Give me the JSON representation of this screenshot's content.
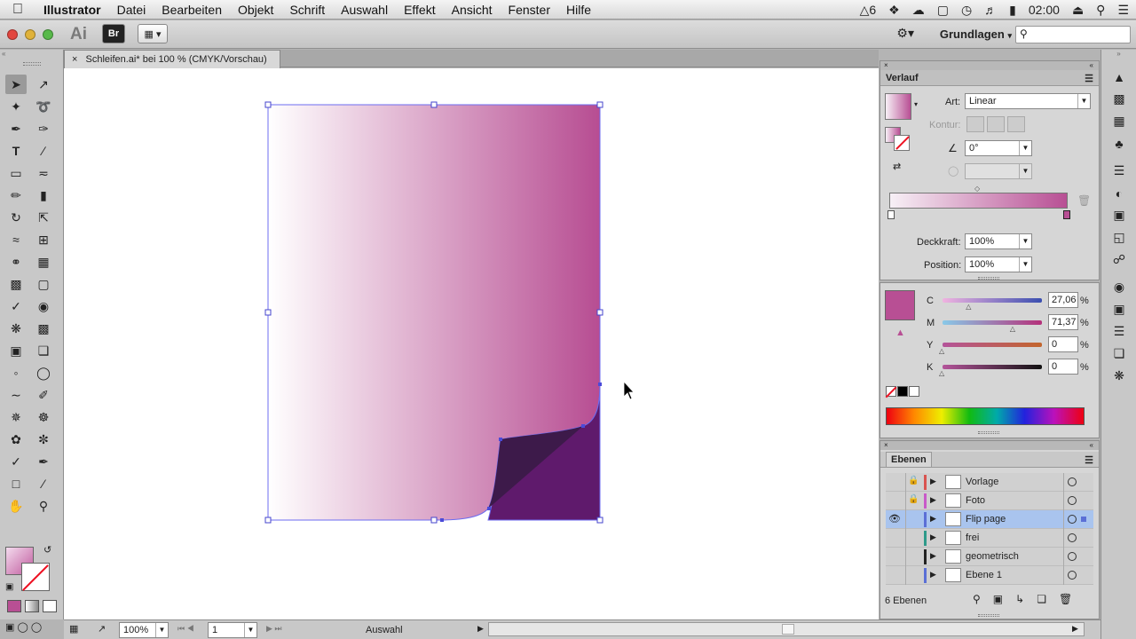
{
  "menubar": {
    "items": [
      "Illustrator",
      "Datei",
      "Bearbeiten",
      "Objekt",
      "Schrift",
      "Auswahl",
      "Effekt",
      "Ansicht",
      "Fenster",
      "Hilfe"
    ],
    "adobe_badge": "6",
    "clock": "02:00"
  },
  "appbar": {
    "app_logo": "Ai",
    "bridge_label": "Br",
    "workspace": "Grundlagen",
    "search_placeholder": ""
  },
  "document": {
    "tab_title": "Schleifen.ai* bei 100 % (CMYK/Vorschau)"
  },
  "gradient_panel": {
    "title": "Verlauf",
    "art_label": "Art:",
    "art_value": "Linear",
    "kontur_label": "Kontur:",
    "angle_value": "0°",
    "deckkraft_label": "Deckkraft:",
    "deckkraft_value": "100%",
    "position_label": "Position:",
    "position_value": "100%",
    "gradient_start": "#f7f0f6",
    "gradient_end": "#b84f94"
  },
  "color_panel": {
    "swatch": "#b84f94",
    "channels": [
      {
        "label": "C",
        "value": "27,06",
        "unit": "%",
        "level": 0.2706
      },
      {
        "label": "M",
        "value": "71,37",
        "unit": "%",
        "level": 0.7137
      },
      {
        "label": "Y",
        "value": "0",
        "unit": "%",
        "level": 0
      },
      {
        "label": "K",
        "value": "0",
        "unit": "%",
        "level": 0
      }
    ]
  },
  "layers_panel": {
    "title": "Ebenen",
    "layers": [
      {
        "name": "Vorlage",
        "locked": true,
        "visible": false,
        "color": "#d9534f"
      },
      {
        "name": "Foto",
        "locked": true,
        "visible": false,
        "color": "#c85ac8"
      },
      {
        "name": "Flip page",
        "locked": false,
        "visible": true,
        "color": "#5b6fd6",
        "selected": true
      },
      {
        "name": "frei",
        "locked": false,
        "visible": false,
        "color": "#2e9a8a"
      },
      {
        "name": "geometrisch",
        "locked": false,
        "visible": false,
        "color": "#222222"
      },
      {
        "name": "Ebene 1",
        "locked": false,
        "visible": false,
        "color": "#5b6fd6"
      }
    ],
    "count_label": "6 Ebenen"
  },
  "statusbar": {
    "zoom": "100%",
    "page": "1",
    "tool_status": "Auswahl"
  },
  "artwork": {
    "gradient_start": "#ffffff",
    "gradient_end": "#b74d92",
    "curl_dark": "#3d1a4a",
    "curl_fill": "#5f1a6c"
  }
}
